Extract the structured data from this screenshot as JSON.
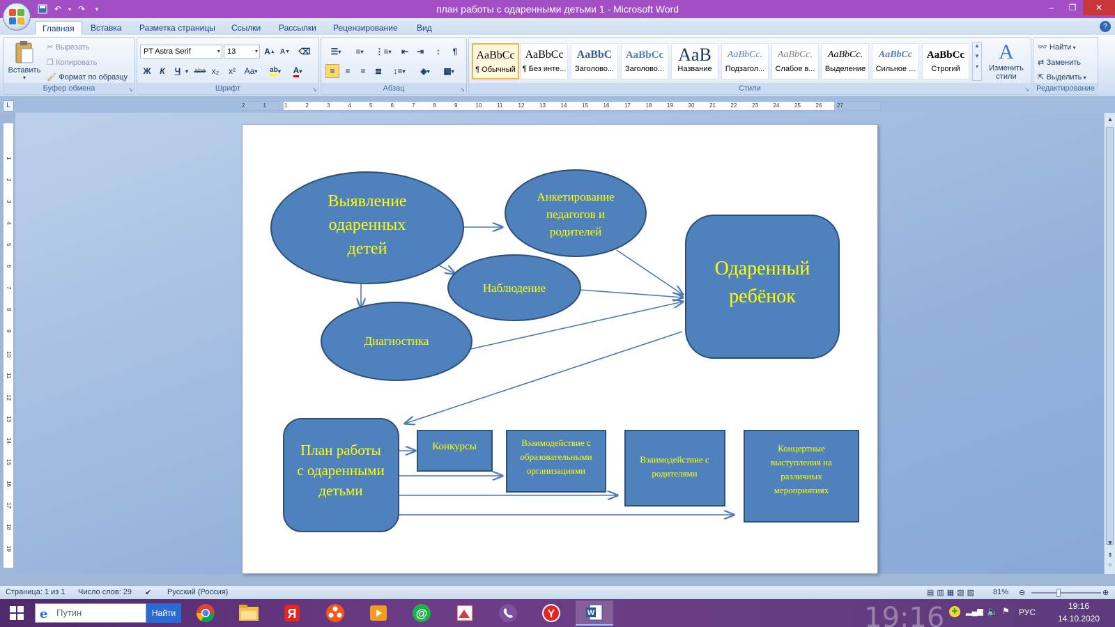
{
  "window": {
    "title": "план работы с одаренными детьми 1 - Microsoft Word",
    "controls": [
      "minimize-icon",
      "restore-icon",
      "close-icon"
    ]
  },
  "quick_access": [
    "save-icon",
    "undo-icon",
    "redo-icon",
    "customize-icon"
  ],
  "tabs": [
    {
      "label": "Главная",
      "active": true
    },
    {
      "label": "Вставка"
    },
    {
      "label": "Разметка страницы"
    },
    {
      "label": "Ссылки"
    },
    {
      "label": "Рассылки"
    },
    {
      "label": "Рецензирование"
    },
    {
      "label": "Вид"
    }
  ],
  "clipboard": {
    "paste": "Вставить",
    "cut": "Вырезать",
    "copy": "Копировать",
    "format_painter": "Формат по образцу",
    "group_label": "Буфер обмена"
  },
  "font": {
    "name": "PT Astra Serif",
    "size": "13",
    "grow": "A",
    "shrink": "A",
    "bold": "Ж",
    "italic": "К",
    "underline": "Ч",
    "strike": "abe",
    "subscript": "x₂",
    "superscript": "x²",
    "change_case": "Aa",
    "font_color": "A",
    "group_label": "Шрифт"
  },
  "paragraph": {
    "group_label": "Абзац",
    "pilcrow": "¶"
  },
  "styles": {
    "group_label": "Стили",
    "items": [
      {
        "sample": "AaBbCc",
        "name": "¶ Обычный",
        "selected": true
      },
      {
        "sample": "AaBbCc",
        "name": "¶ Без инте..."
      },
      {
        "sample": "AaBbC",
        "name": "Заголово..."
      },
      {
        "sample": "AaBbCc",
        "name": "Заголово..."
      },
      {
        "sample": "AaB",
        "name": "Название"
      },
      {
        "sample": "AaBbCc.",
        "name": "Подзагол..."
      },
      {
        "sample": "AaBbCc.",
        "name": "Слабое в..."
      },
      {
        "sample": "AaBbCc.",
        "name": "Выделение"
      },
      {
        "sample": "AaBbCc",
        "name": "Сильное ..."
      },
      {
        "sample": "AaBbCc",
        "name": "Строгий"
      }
    ],
    "change_styles": "Изменить стили"
  },
  "editing": {
    "find": "Найти",
    "replace": "Заменить",
    "select": "Выделить",
    "group_label": "Редактирование"
  },
  "ruler_numbers": [
    "2",
    "1",
    "1",
    "2",
    "3",
    "4",
    "5",
    "6",
    "7",
    "8",
    "9",
    "10",
    "11",
    "12",
    "13",
    "14",
    "15",
    "16",
    "17",
    "18",
    "19",
    "20",
    "21",
    "22",
    "23",
    "24",
    "25",
    "26",
    "27"
  ],
  "vruler_numbers": [
    "1",
    "2",
    "3",
    "4",
    "5",
    "6",
    "7",
    "8",
    "9",
    "10",
    "11",
    "12",
    "13",
    "14",
    "15",
    "16",
    "17",
    "18",
    "19"
  ],
  "diagram": {
    "nodes": {
      "identify": [
        "Выявление",
        "одаренных",
        "детей"
      ],
      "survey": [
        "Анкетирование",
        "педагогов и",
        "родителей"
      ],
      "observation": [
        "Наблюдение"
      ],
      "diagnostics": [
        "Диагностика"
      ],
      "gifted": [
        "Одаренный",
        "ребёнок"
      ],
      "plan": [
        "План работы",
        "с одаренными",
        "детьми"
      ],
      "contests": [
        "Конкурсы"
      ],
      "edu_orgs": [
        "Взаимодействие с",
        "образовательными",
        "организациями"
      ],
      "parents": [
        "Взаимодействие с",
        "родителями"
      ],
      "concerts": [
        "Концертные",
        "выступления на",
        "различных",
        "мероприятиях"
      ]
    },
    "fill_color": "#4f81bd",
    "stroke_color": "#385d8a",
    "text_color": "#ffff00"
  },
  "status": {
    "page": "Страница: 1 из 1",
    "words": "Число слов: 29",
    "language": "Русский (Россия)",
    "zoom": "81%"
  },
  "taskbar": {
    "search_placeholder": "Путин",
    "search_button": "Найти",
    "apps": [
      "chrome-icon",
      "explorer-icon",
      "yandex-icon",
      "media-icon",
      "video-icon",
      "mail-icon",
      "photo-icon",
      "viber-icon",
      "yandex-browser-icon",
      "word-icon"
    ],
    "clock_big": "19:16",
    "time": "19:16",
    "date": "14.10.2020",
    "lang": "РУС"
  }
}
